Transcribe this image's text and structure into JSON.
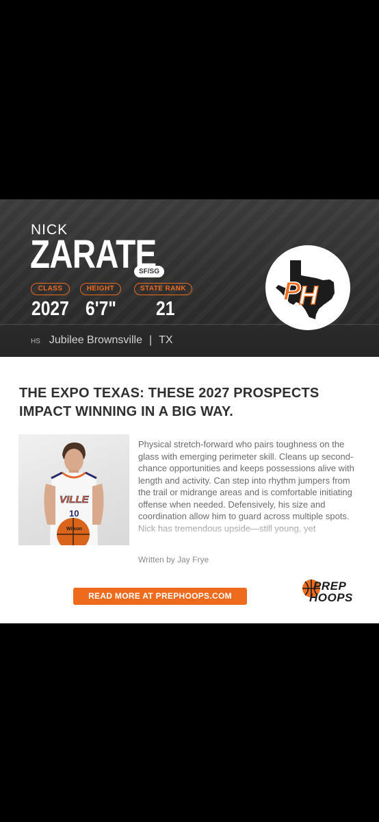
{
  "player": {
    "first_name": "NICK",
    "last_name": "ZARATE",
    "position": "SF/SG",
    "stats": [
      {
        "label": "CLASS",
        "value": "2027"
      },
      {
        "label": "HEIGHT",
        "value": "6'7\""
      },
      {
        "label": "STATE RANK",
        "value": "21"
      }
    ],
    "hs_label": "HS",
    "school": "Jubilee Brownsville",
    "separator": "|",
    "state": "TX"
  },
  "logo": {
    "letters": "PH",
    "icon": "texas-map-icon"
  },
  "article": {
    "headline": "THE EXPO TEXAS: THESE 2027 PROSPECTS IMPACT WINNING IN A BIG WAY.",
    "body": "Physical stretch-forward who pairs toughness on the glass with emerging perimeter skill. Cleans up second-chance opportunities and keeps possessions alive with length and activity. Can step into rhythm jumpers from the trail or midrange areas and is comfortable initiating offense when needed. Defensively, his size and coordination allow him to guard across multiple spots. Nick has tremendous upside—still young, yet",
    "byline": "Written by Jay Frye",
    "jersey_text": "VILLE",
    "jersey_number": "10",
    "ball_text": "Wilson"
  },
  "cta": {
    "label": "READ MORE AT PREPHOOPS.COM"
  },
  "brand": {
    "line1": "PREP",
    "line2": "HOOPS"
  },
  "colors": {
    "accent": "#ee6a1c",
    "header_bg": "#333333",
    "headline": "#2f2f2f"
  }
}
